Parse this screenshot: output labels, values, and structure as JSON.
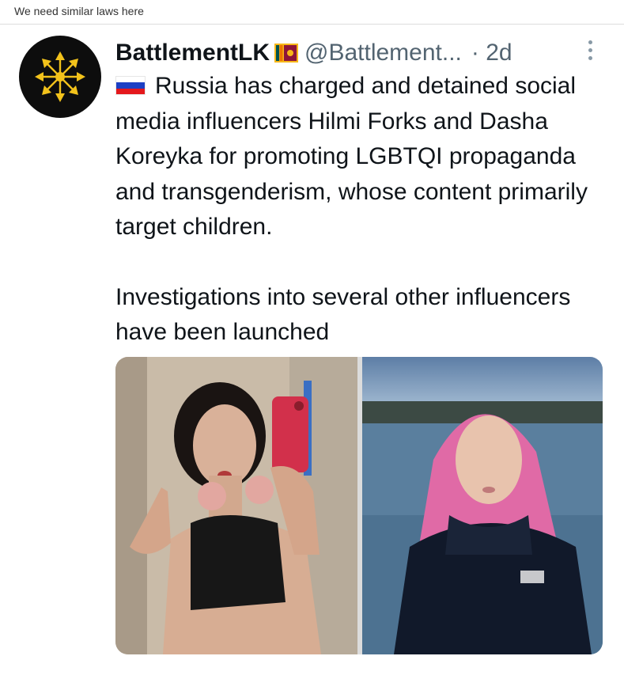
{
  "post_caption": "We need similar laws here",
  "tweet": {
    "author_name": "BattlementLK",
    "author_flag": "sri-lanka-flag-icon",
    "handle": "@Battlement...",
    "time": "· 2d",
    "flag": "russia-flag-icon",
    "text_paragraph_1": "Russia has charged and detained social media influencers Hilmi Forks and Dasha Koreyka for promoting LGBTQI propaganda and transgenderism, whose content primarily target children.",
    "text_paragraph_2": "Investigations into several other influencers have been launched",
    "media": [
      {
        "type": "photo",
        "description_icon": "mirror-selfie-photo"
      },
      {
        "type": "photo",
        "description_icon": "lake-portrait-photo"
      }
    ]
  },
  "colors": {
    "text": "#0f1419",
    "secondary": "#536471",
    "avatar_bg": "#0d0d0d",
    "avatar_arrows": "#f2c21b"
  }
}
